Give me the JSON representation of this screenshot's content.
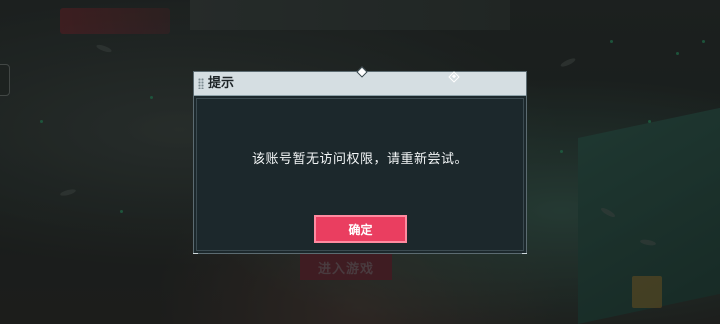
{
  "background": {
    "enter_game_label": "进入游戏"
  },
  "dialog": {
    "title": "提示",
    "message": "该账号暂无访问权限，请重新尝试。",
    "confirm_label": "确定"
  },
  "colors": {
    "confirm_button": "#ea3e60",
    "dialog_header": "#d5dee2",
    "dialog_body": "#1c282c"
  },
  "icons": {
    "header_ornament_left": "diamond-icon",
    "header_ornament_right": "diamond-outline-icon",
    "grip": "grip-dots-icon"
  }
}
